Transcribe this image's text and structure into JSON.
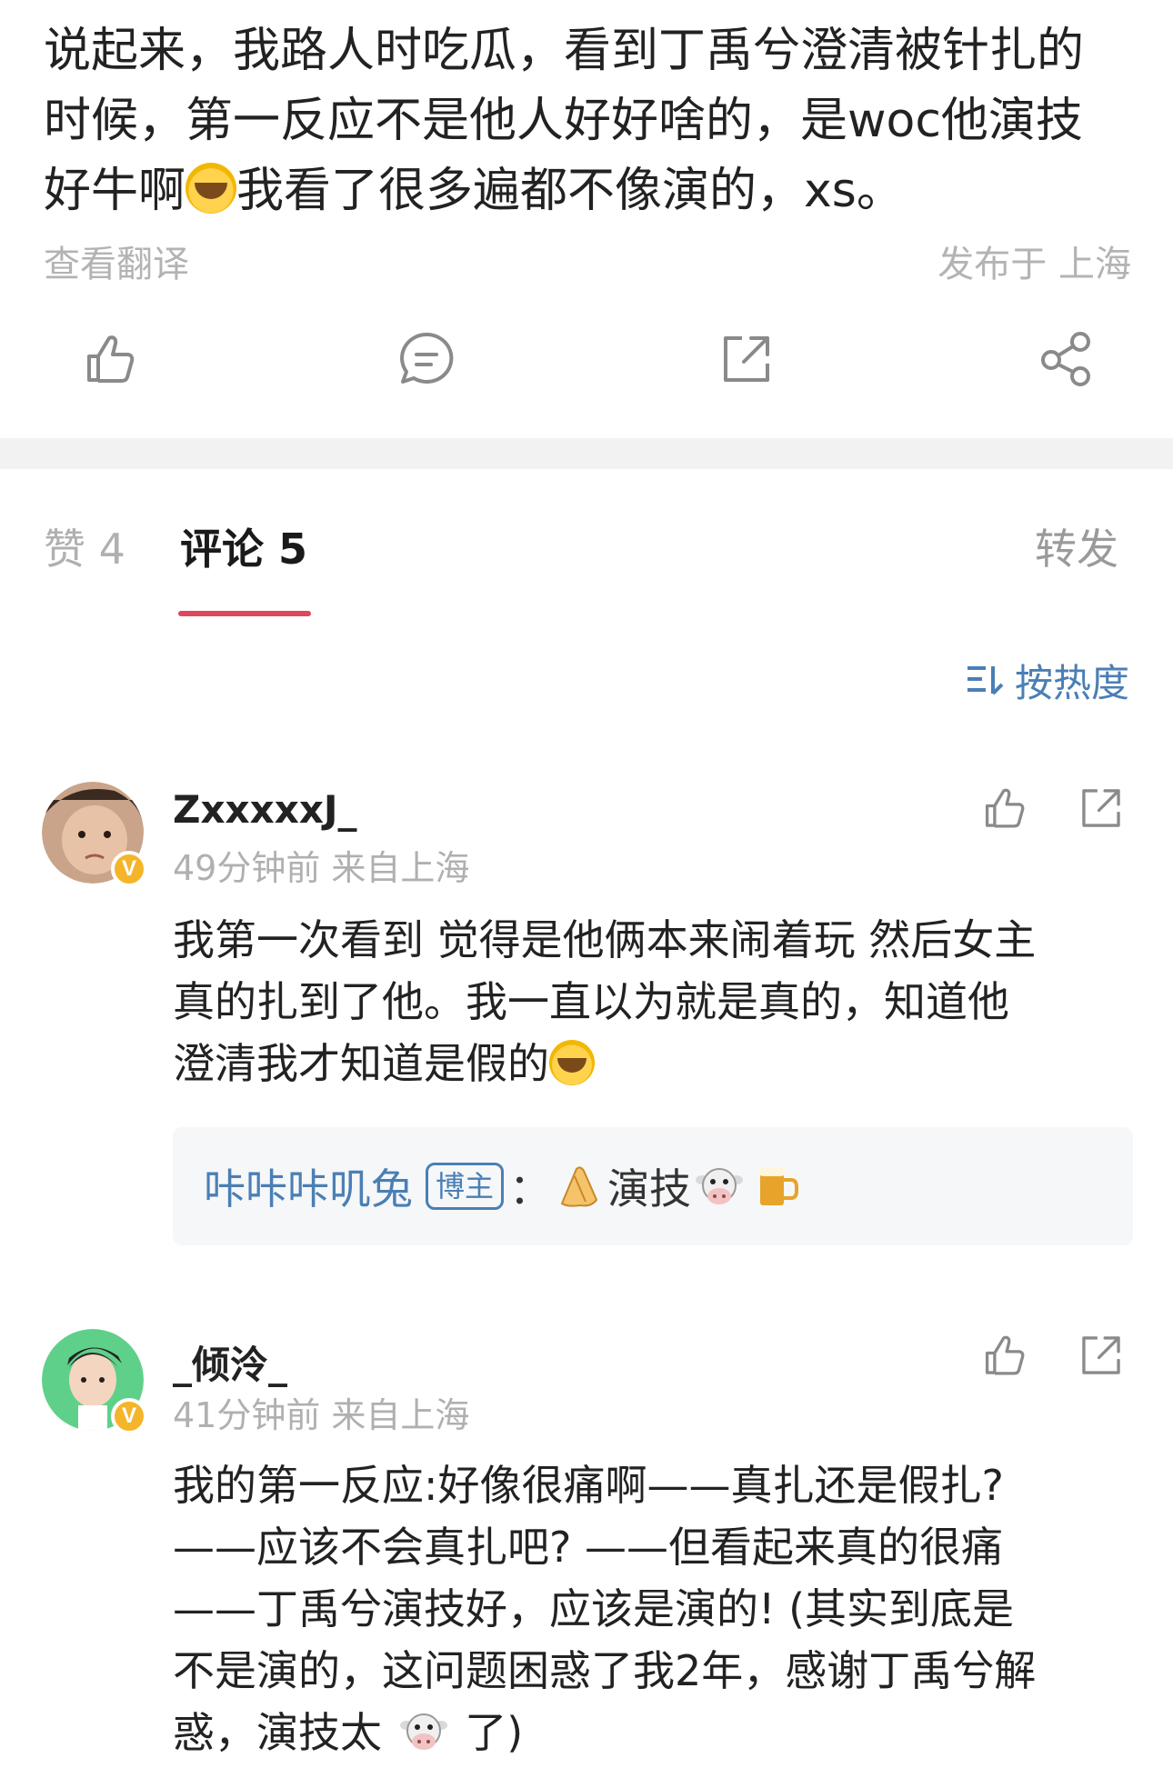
{
  "post": {
    "line1": "说起来，我路人时吃瓜，看到丁禹兮澄清被针扎的",
    "line2": "时候，第一反应不是他人好好啥的，是woc他演技",
    "line3a": "好牛啊",
    "line3b": "我看了很多遍都不像演的，xs。",
    "translate": "查看翻译",
    "location": "发布于 上海"
  },
  "tabs": {
    "likes": "赞 4",
    "comments": "评论 5",
    "repost": "转发"
  },
  "sort_label": "按热度",
  "comments": [
    {
      "name": "ZxxxxxJ_",
      "meta": "49分钟前   来自上海",
      "line1": "我第一次看到 觉得是他俩本来闹着玩 然后女主",
      "line2": "真的扎到了他。我一直以为就是真的，知道他",
      "line3": "澄清我才知道是假的",
      "reply_user": "咔咔咔叽兔",
      "reply_badge": "博主",
      "reply_colon": "：",
      "reply_text": "演技"
    },
    {
      "name": "_倾泠_",
      "meta": "41分钟前   来自上海",
      "line1": "我的第一反应:好像很痛啊——真扎还是假扎?",
      "line2": "——应该不会真扎吧? ——但看起来真的很痛",
      "line3": "——丁禹兮演技好，应该是演的! (其实到底是",
      "line4": "不是演的，这问题困惑了我2年，感谢丁禹兮解",
      "line5a": "惑，演技太",
      "line5b": "了)"
    }
  ],
  "colors": {
    "accent": "#e0465e",
    "link": "#4a7fb5",
    "badge": "#f5b52a"
  }
}
